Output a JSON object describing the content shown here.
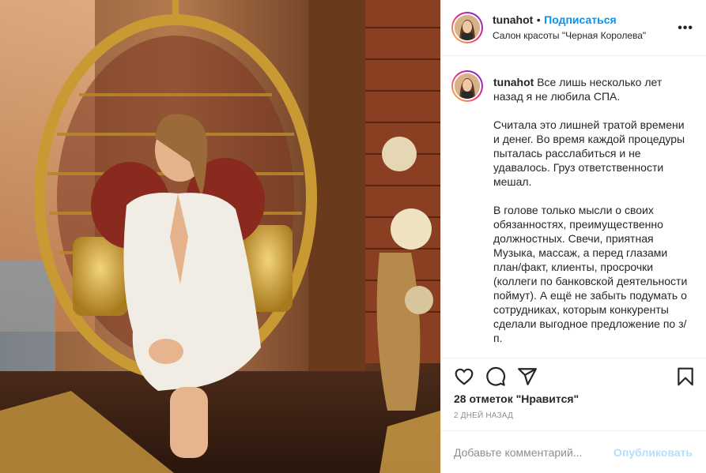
{
  "post": {
    "username": "tunahot",
    "follow_label": "Подписаться",
    "separator": "•",
    "location": "Салон красоты \"Черная Королева\"",
    "more_icon": "more-horizontal-icon"
  },
  "caption": {
    "username": "tunahot",
    "text": " Все лишь несколько лет назад я не любила СПА.\n\nСчитала это лишней тратой времени и денег. Во время каждой процедуры пыталась расслабиться и не удавалось. Груз ответственности мешал.\n\nВ голове только мысли о своих обязанностях, преимущественно должностных. Свечи, приятная Музыка, массаж, а перед глазами план/факт, клиенты, просрочки (коллеги по банковской деятельности поймут). А ещё не забыть подумать о сотрудниках, которым конкуренты сделали выгодное предложение по з/п."
  },
  "actions": {
    "icons": [
      "heart-icon",
      "comment-icon",
      "share-icon",
      "bookmark-icon"
    ],
    "likes": "28 отметок \"Нравится\"",
    "time": "2 ДНЕЙ НАЗАД"
  },
  "comment": {
    "placeholder": "Добавьте комментарий...",
    "publish_label": "Опубликовать"
  },
  "colors": {
    "accent": "#0095f6",
    "publish_disabled": "#b2dffc",
    "secondary_text": "#8e8e8e"
  }
}
